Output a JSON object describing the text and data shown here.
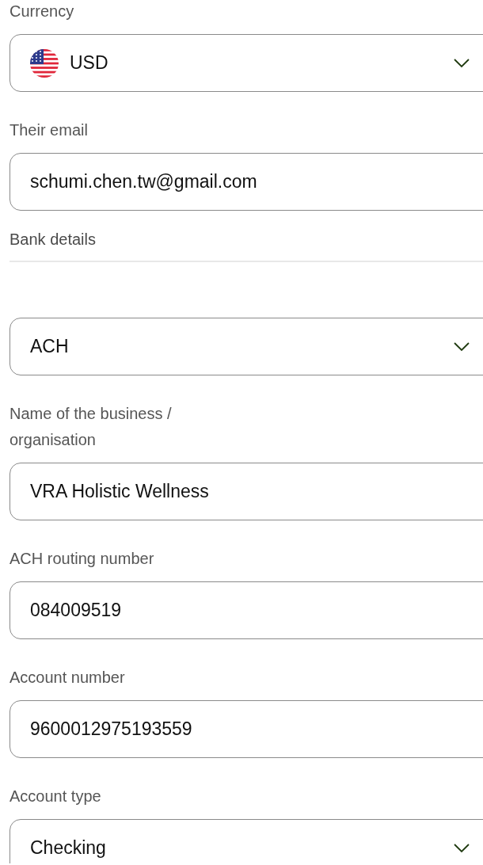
{
  "items": [
    {
      "kind": "flag_select",
      "label": "Currency",
      "value": "USD"
    },
    {
      "kind": "text",
      "label": "Their email",
      "value": "schumi.chen.tw@gmail.com"
    },
    {
      "kind": "section",
      "label": "Bank details"
    },
    {
      "kind": "select",
      "value": "ACH"
    },
    {
      "kind": "text",
      "label": "Name of the business / organisation",
      "value": "VRA Holistic Wellness"
    },
    {
      "kind": "text",
      "label": "ACH routing number",
      "value": "084009519"
    },
    {
      "kind": "text",
      "label": "Account number",
      "value": "9600012975193559"
    },
    {
      "kind": "select",
      "label": "Account type",
      "value": "Checking"
    }
  ]
}
